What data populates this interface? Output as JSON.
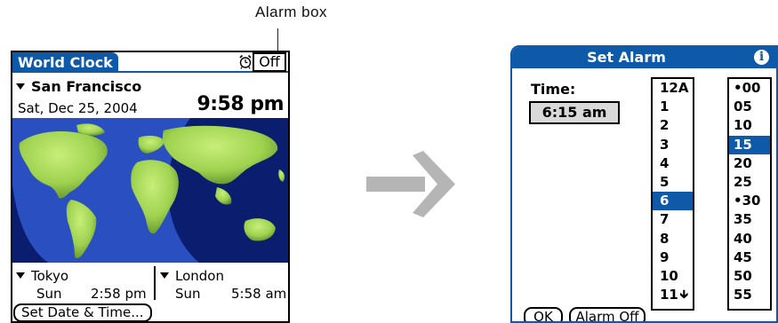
{
  "callout": {
    "label": "Alarm box"
  },
  "world_clock": {
    "title": "World Clock",
    "alarm_box_value": "Off",
    "primary": {
      "city": "San Francisco",
      "date": "Sat, Dec 25, 2004",
      "time": "9:58 pm"
    },
    "secondary": [
      {
        "city": "Tokyo",
        "day": "Sun",
        "time": "2:58 pm"
      },
      {
        "city": "London",
        "day": "Sun",
        "time": "5:58 am"
      }
    ],
    "set_date_button": "Set Date & Time..."
  },
  "set_alarm": {
    "title": "Set Alarm",
    "info_icon": "i",
    "time_label": "Time:",
    "time_value": "6:15 am",
    "hours": [
      "12A",
      "1",
      "2",
      "3",
      "4",
      "5",
      "6",
      "7",
      "8",
      "9",
      "10",
      "11"
    ],
    "selected_hour": "6",
    "minutes": [
      "•00",
      "05",
      "10",
      "15",
      "20",
      "25",
      "•30",
      "35",
      "40",
      "45",
      "50",
      "55"
    ],
    "selected_minute": "15",
    "ok_button": "OK",
    "alarm_off_button": "Alarm Off"
  },
  "colors": {
    "palm_blue": "#0e5aa8",
    "arrow_gray": "#b5b5b5",
    "map_night": "#0b1d6e",
    "map_day": "#2a4fc0",
    "land": "#a9dd5a"
  }
}
